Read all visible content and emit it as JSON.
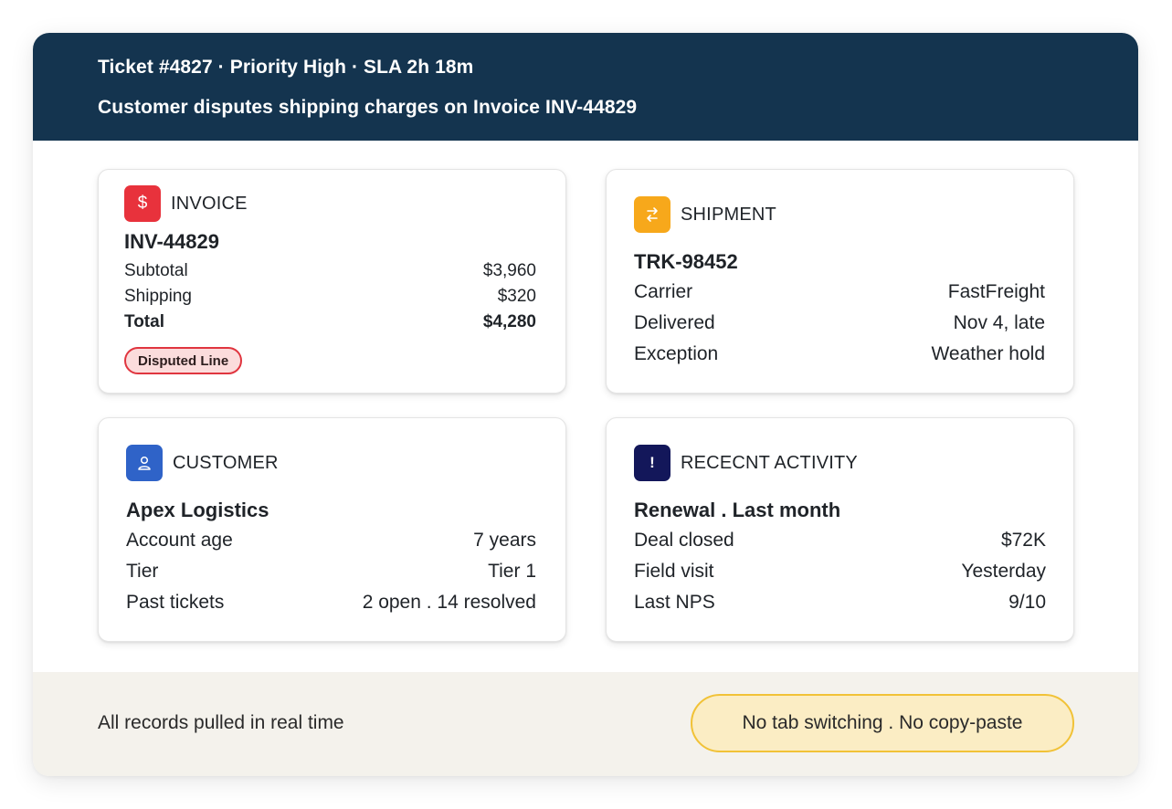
{
  "header": {
    "line1": "Ticket #4827 · Priority High · SLA 2h 18m",
    "line2": "Customer disputes shipping charges on Invoice INV-44829"
  },
  "invoice": {
    "icon": "dollar-icon",
    "label": "INVOICE",
    "title": "INV-44829",
    "rows": [
      {
        "label": "Subtotal",
        "value": "$3,960"
      },
      {
        "label": "Shipping",
        "value": "$320"
      },
      {
        "label": "Total",
        "value": "$4,280"
      }
    ],
    "tag": "Disputed Line",
    "accent": "#e8323c"
  },
  "shipment": {
    "icon": "swap-arrows-icon",
    "label": "SHIPMENT",
    "title": "TRK-98452",
    "rows": [
      {
        "label": "Carrier",
        "value": "FastFreight"
      },
      {
        "label": "Delivered",
        "value": "Nov 4, late"
      },
      {
        "label": "Exception",
        "value": "Weather hold"
      }
    ],
    "accent": "#f7a81b"
  },
  "customer": {
    "icon": "user-icon",
    "label": "CUSTOMER",
    "title": "Apex Logistics",
    "rows": [
      {
        "label": "Account age",
        "value": "7 years"
      },
      {
        "label": "Tier",
        "value": "Tier 1"
      },
      {
        "label": "Past tickets",
        "value": "2 open . 14 resolved"
      }
    ],
    "accent": "#2f63c8"
  },
  "activity": {
    "icon": "exclamation-icon",
    "label": "RECECNT ACTIVITY",
    "title": "Renewal . Last month",
    "rows": [
      {
        "label": "Deal closed",
        "value": "$72K"
      },
      {
        "label": "Field visit",
        "value": "Yesterday"
      },
      {
        "label": "Last NPS",
        "value": "9/10"
      }
    ],
    "accent": "#13175a"
  },
  "footer": {
    "note": "All records pulled in real time",
    "pill": "No tab switching . No copy-paste"
  },
  "colors": {
    "header_bg": "#14344f",
    "footer_bg": "#f4f2ec",
    "pill_border": "#f1c237",
    "pill_bg": "#fbedc4",
    "disputed_border": "#e0353f",
    "disputed_bg": "#fbdcdc"
  }
}
